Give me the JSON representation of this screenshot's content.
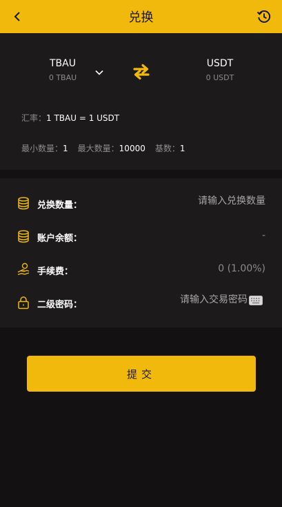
{
  "header": {
    "title": "兑换",
    "back_icon": "chevron-left-icon",
    "history_icon": "history-icon"
  },
  "pair": {
    "from": {
      "symbol": "TBAU",
      "balance": "0 TBAU"
    },
    "to": {
      "symbol": "USDT",
      "balance": "0 USDT"
    },
    "dropdown_icon": "chevron-down-icon",
    "swap_icon": "swap-arrows-icon"
  },
  "rate": {
    "label": "汇率：",
    "value": "1 TBAU = 1 USDT"
  },
  "limits": {
    "min_label": "最小数量：",
    "min_value": "1",
    "max_label": "最大数量：",
    "max_value": "10000",
    "base_label": "基数：",
    "base_value": "1"
  },
  "form": {
    "amount": {
      "icon": "coins-icon",
      "label": "兑换数量：",
      "placeholder": "请输入兑换数量"
    },
    "balance": {
      "icon": "coins-icon",
      "label": "账户余额：",
      "value": "-"
    },
    "fee": {
      "icon": "hand-coin-icon",
      "label": "手续费：",
      "value": "0 (1.00%)"
    },
    "password": {
      "icon": "lock-icon",
      "label": "二级密码：",
      "placeholder": "请输入交易密码",
      "keyboard_icon": "keyboard-icon"
    }
  },
  "submit_label": "提交",
  "colors": {
    "accent": "#f0b90b",
    "background": "#131112",
    "panel": "#1c1a1b"
  }
}
